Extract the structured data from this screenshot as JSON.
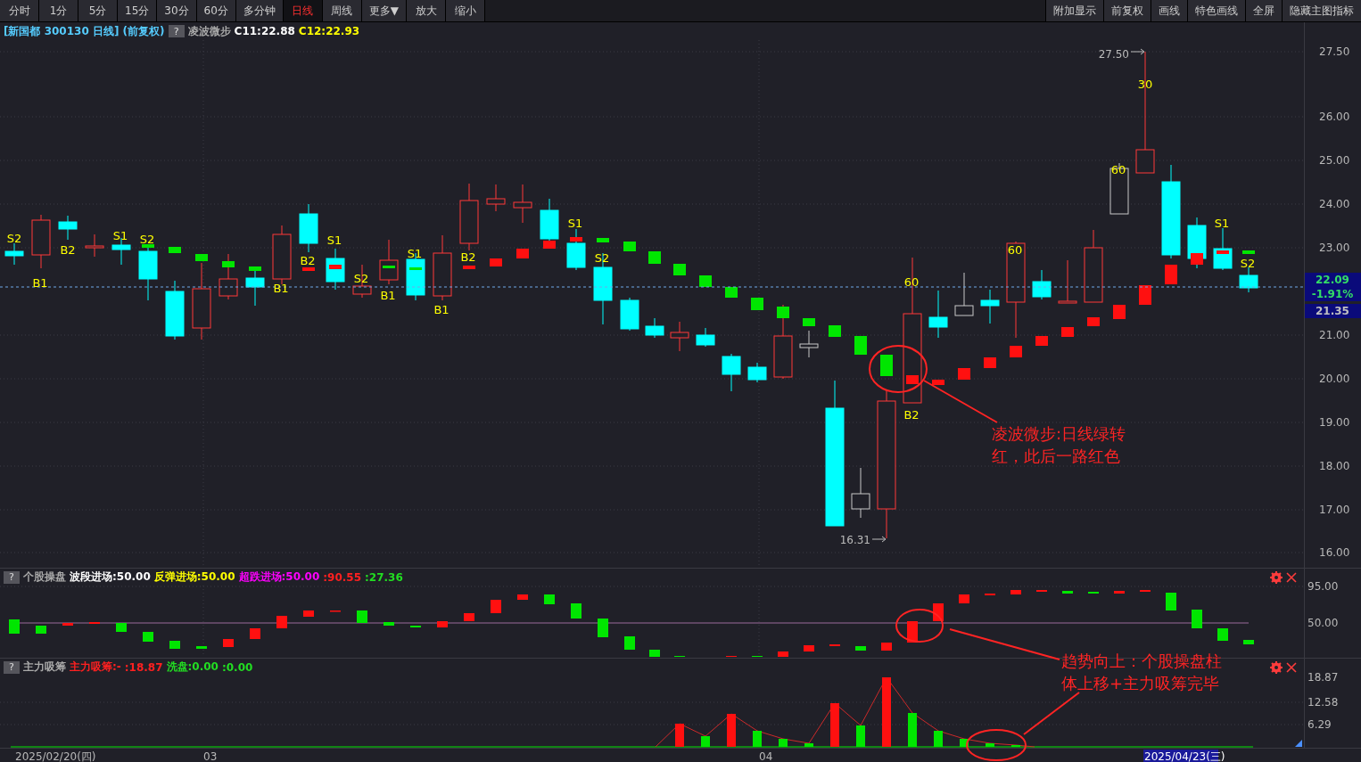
{
  "toolbar": {
    "periods": [
      {
        "label": "分时",
        "selected": false
      },
      {
        "label": "1分",
        "selected": false
      },
      {
        "label": "5分",
        "selected": false
      },
      {
        "label": "15分",
        "selected": false
      },
      {
        "label": "30分",
        "selected": false
      },
      {
        "label": "60分",
        "selected": false
      },
      {
        "label": "多分钟",
        "selected": false
      },
      {
        "label": "日线",
        "selected": true
      },
      {
        "label": "周线",
        "selected": false
      },
      {
        "label": "更多▼",
        "selected": false
      },
      {
        "label": "放大",
        "selected": false
      },
      {
        "label": "缩小",
        "selected": false
      }
    ],
    "actions": [
      "附加显示",
      "前复权",
      "画线",
      "特色画线",
      "全屏",
      "隐藏主图指标"
    ]
  },
  "main_chart": {
    "title": "[新国都 300130 日线] (前复权)",
    "help": "?",
    "indicator": "凌波微步",
    "legend": [
      {
        "text": "C11:22.88",
        "color": "#ffffff"
      },
      {
        "text": "C12:22.93",
        "color": "#ffff00"
      }
    ],
    "signals": [
      "S2",
      "B1",
      "B2",
      "S1",
      "S2",
      "B1",
      "B2",
      "S1",
      "S2",
      "B1",
      "S1",
      "B1",
      "B2",
      "S1",
      "S2",
      "60",
      "B2",
      "60",
      "60",
      "30",
      "S1",
      "S2"
    ],
    "high_label": "27.50",
    "low_label": "16.31",
    "y_axis": [
      "27.50",
      "26.00",
      "25.00",
      "24.00",
      "23.00",
      "21.00",
      "20.00",
      "19.00",
      "18.00",
      "17.00",
      "16.00"
    ],
    "price_tags": [
      {
        "text": "22.09",
        "kind": "price"
      },
      {
        "text": "-1.91%",
        "kind": "change"
      },
      {
        "text": "21.35",
        "kind": "reference"
      }
    ]
  },
  "panels": [
    {
      "help": "?",
      "name": "个股操盘",
      "legend": [
        {
          "text": "波段进场:50.00",
          "color": "#ffffff"
        },
        {
          "text": "反弹进场:50.00",
          "color": "#ffff00"
        },
        {
          "text": "超跌进场:50.00",
          "color": "#ff00ff"
        },
        {
          "text": ":90.55",
          "color": "#ff2020"
        },
        {
          "text": ":27.36",
          "color": "#22dd22"
        }
      ],
      "y_axis": [
        "95.00",
        "50.00"
      ]
    },
    {
      "help": "?",
      "name": "主力吸筹",
      "legend": [
        {
          "text": "主力吸筹:-",
          "color": "#ff2020"
        },
        {
          "text": ":18.87",
          "color": "#ff2020"
        },
        {
          "text": "洗盘:0.00",
          "color": "#22dd22"
        },
        {
          "text": ":0.00",
          "color": "#22dd22"
        }
      ],
      "y_axis": [
        "18.87",
        "12.58",
        "6.29"
      ]
    }
  ],
  "dates": [
    {
      "text": "2025/02/20(四)",
      "selected": false
    },
    {
      "text": "03",
      "selected": false
    },
    {
      "text": "04",
      "selected": false
    },
    {
      "text": "2025/04/23(三)",
      "selected": true
    }
  ],
  "annotations": [
    {
      "lines": [
        "凌波微步:日线绿转",
        "红，此后一路红色"
      ]
    },
    {
      "lines": [
        "趋势向上：个股操盘柱",
        "体上移+主力吸筹完毕"
      ]
    }
  ]
}
